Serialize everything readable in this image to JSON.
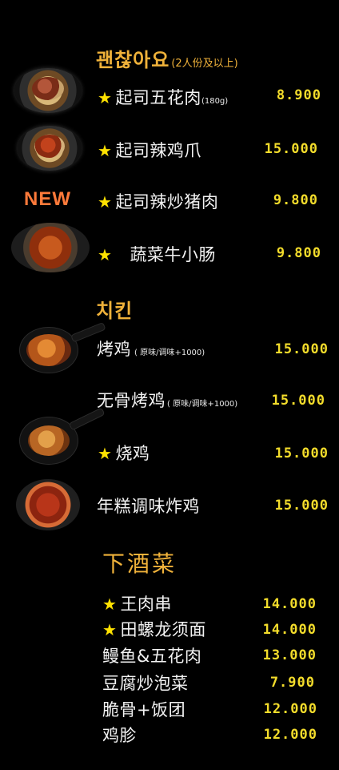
{
  "sections": [
    {
      "title_kr": "괜찮아요",
      "subtitle": "(2人份及以上)",
      "items": [
        {
          "star": true,
          "name": "起司五花肉",
          "note": "(180g)",
          "price": "8.900"
        },
        {
          "star": true,
          "name": "起司辣鸡爪",
          "note": "",
          "price": "15.000"
        },
        {
          "star": true,
          "name": "起司辣炒猪肉",
          "note": "",
          "price": "9.800",
          "badge": "NEW"
        },
        {
          "star": true,
          "name": "蔬菜牛小肠",
          "note": "",
          "price": "9.800"
        }
      ]
    },
    {
      "title_kr": "치킨",
      "items": [
        {
          "star": false,
          "name": "烤鸡",
          "note": "( 原味/调味+1000)",
          "price": "15.000"
        },
        {
          "star": false,
          "name": "无骨烤鸡",
          "note": "( 原味/调味+1000)",
          "price": "15.000"
        },
        {
          "star": true,
          "name": "烧鸡",
          "note": "",
          "price": "15.000"
        },
        {
          "star": false,
          "name": "年糕调味炸鸡",
          "note": "",
          "price": "15.000"
        }
      ]
    },
    {
      "title_cn": "下酒菜",
      "items": [
        {
          "star": true,
          "name": "王肉串",
          "price": "14.000"
        },
        {
          "star": true,
          "name": "田螺龙须面",
          "price": "14.000"
        },
        {
          "star": false,
          "name": "鳗鱼&五花肉",
          "price": "13.000"
        },
        {
          "star": false,
          "name": "豆腐炒泡菜",
          "price": "7.900"
        },
        {
          "star": false,
          "name": "脆骨+饭团",
          "price": "12.000"
        },
        {
          "star": false,
          "name": "鸡胗",
          "price": "12.000"
        }
      ]
    }
  ],
  "star_symbol": "★",
  "colors": {
    "background": "#000000",
    "price": "#f3dc2b",
    "section_title": "#f0b23a",
    "new_badge": "#ff7a3a",
    "star": "#ffe200"
  }
}
